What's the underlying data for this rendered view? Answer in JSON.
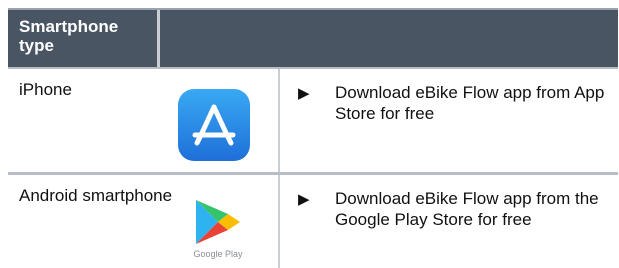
{
  "header": {
    "type_label": "Smartphone type"
  },
  "rows": [
    {
      "type": "iPhone",
      "icon": "app-store-icon",
      "bullet": "▶",
      "instruction": "Download eBike Flow app from App Store for free"
    },
    {
      "type": "Android smartphone",
      "icon": "google-play-icon",
      "icon_caption": "Google Play",
      "bullet": "▶",
      "instruction": "Download eBike Flow app from the Google Play Store for free"
    }
  ],
  "colors": {
    "header_bg": "#4a5563",
    "app_store_blue": "#1f6fd9"
  }
}
